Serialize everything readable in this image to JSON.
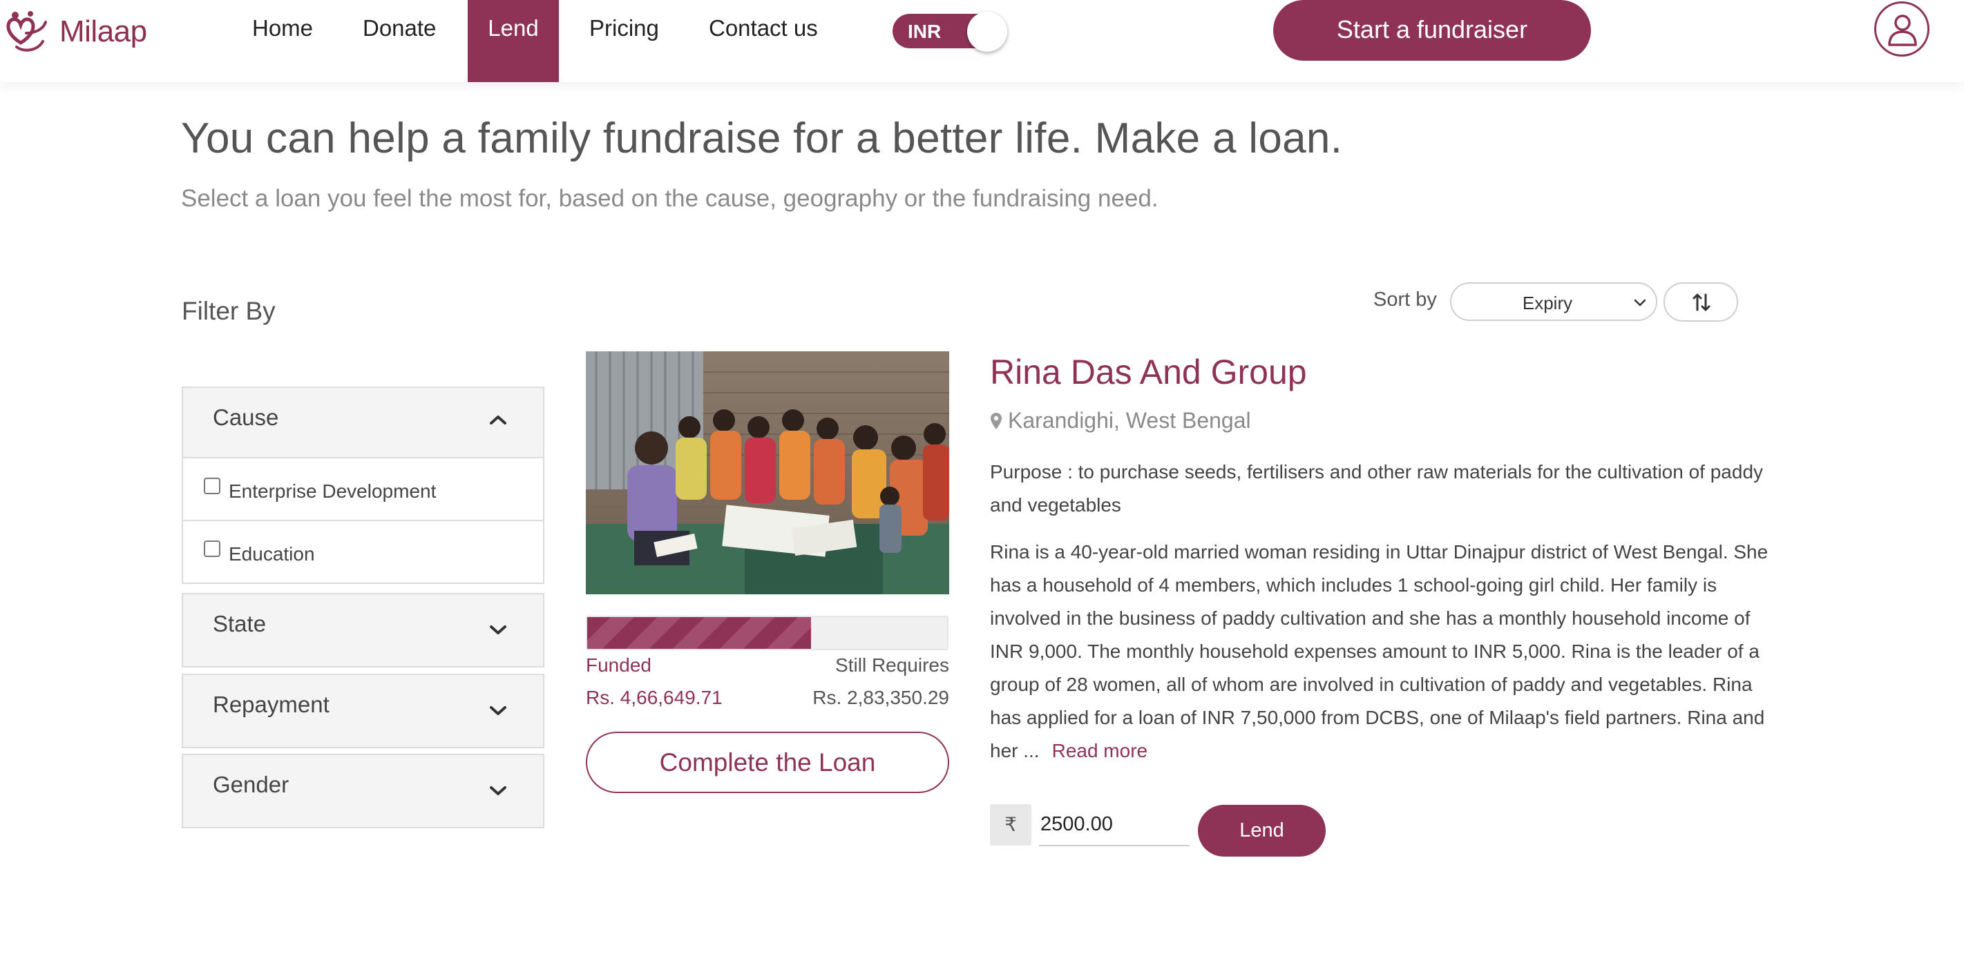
{
  "brand": {
    "name": "Milaap",
    "color": "#8f3356"
  },
  "nav": {
    "home": "Home",
    "donate": "Donate",
    "lend": "Lend",
    "pricing": "Pricing",
    "contact": "Contact us",
    "active": "Lend"
  },
  "currency_toggle": {
    "label": "INR",
    "on": true
  },
  "cta": {
    "start_fundraiser": "Start a fundraiser"
  },
  "user_icon": "user-icon",
  "page": {
    "headline": "You can help a family fundraise for a better life. Make a loan.",
    "subline": "Select a loan you feel the most for, based on the cause, geography or the fundraising need."
  },
  "filters": {
    "title": "Filter By",
    "sections": [
      {
        "label": "Cause",
        "expanded": true,
        "options": [
          "Enterprise Development",
          "Education"
        ]
      },
      {
        "label": "State",
        "expanded": false
      },
      {
        "label": "Repayment",
        "expanded": false
      },
      {
        "label": "Gender",
        "expanded": false
      }
    ]
  },
  "sort": {
    "label": "Sort by",
    "selected": "Expiry"
  },
  "loan": {
    "name": "Rina Das And Group",
    "location": "Karandighi, West Bengal",
    "purpose": "Purpose : to purchase seeds, fertilisers and other raw materials for the cultivation of paddy and vegetables",
    "description": "Rina is a 40-year-old married woman residing in Uttar Dinajpur district of West Bengal. She has a household of 4 members, which includes 1 school-going girl child. Her family is involved in the business of paddy cultivation and she has a monthly household income of INR 9,000. The monthly household expenses amount to INR 5,000. Rina is the leader of a group of 28 women, all of whom are involved in cultivation of paddy and vegetables. Rina has applied for a loan of INR 7,50,000 from DCBS, one of Milaap's field partners. Rina and her ...",
    "read_more": "Read more",
    "funded_label": "Funded",
    "funded_value": "Rs. 4,66,649.71",
    "requires_label": "Still Requires",
    "requires_value": "Rs. 2,83,350.29",
    "funded_fraction": 0.622,
    "complete_button": "Complete the Loan",
    "currency_symbol": "₹",
    "amount": "2500.00",
    "lend_button": "Lend"
  }
}
